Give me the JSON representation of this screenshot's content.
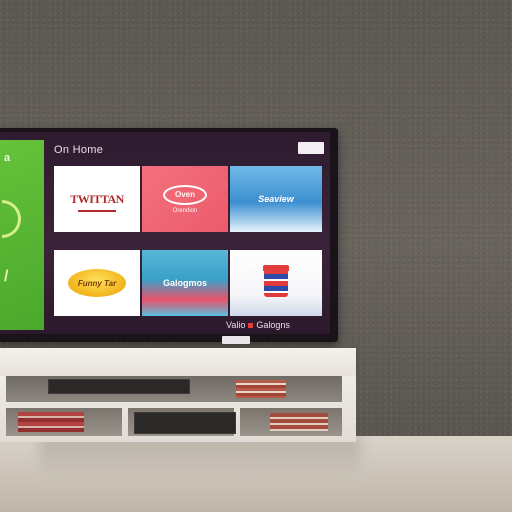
{
  "scene": {
    "colors": {
      "wall": "#5f5a55",
      "floor": "#d5cdc2",
      "tv_bezel": "#1a141a",
      "screen_bg": "#33203a",
      "accent_green": "#5ab634"
    }
  },
  "tv_ui": {
    "header_title": "On Home",
    "side_panel": {
      "label": "a"
    },
    "tiles": [
      {
        "label": "TWITTAN"
      },
      {
        "label": "Oven",
        "sublabel": "Orendion"
      },
      {
        "label": "Seaview"
      },
      {
        "label": "Funny Tar"
      },
      {
        "label": "Galogmos"
      },
      {
        "label": ""
      }
    ],
    "footer_text_left": "Valio",
    "footer_text_right": "Galogns"
  }
}
